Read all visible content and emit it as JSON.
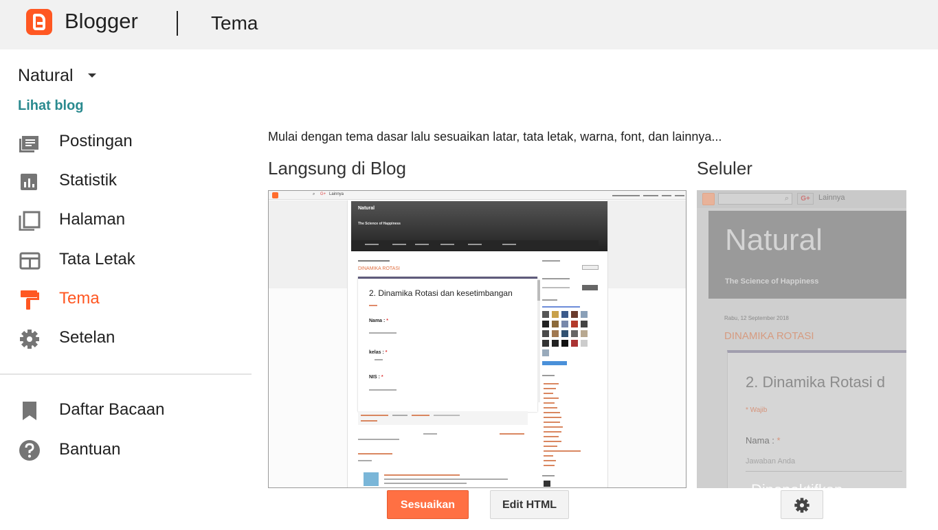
{
  "header": {
    "brand": "Blogger",
    "page_title": "Tema"
  },
  "sidebar": {
    "blog_name": "Natural",
    "view_blog": "Lihat blog",
    "items": [
      {
        "label": "Postingan",
        "icon": "posts-icon"
      },
      {
        "label": "Statistik",
        "icon": "stats-icon"
      },
      {
        "label": "Halaman",
        "icon": "pages-icon"
      },
      {
        "label": "Tata Letak",
        "icon": "layout-icon"
      },
      {
        "label": "Tema",
        "icon": "theme-paint-roller-icon",
        "active": true
      },
      {
        "label": "Setelan",
        "icon": "gear-icon"
      }
    ],
    "secondary_items": [
      {
        "label": "Daftar Bacaan",
        "icon": "bookmark-icon"
      },
      {
        "label": "Bantuan",
        "icon": "help-icon"
      }
    ]
  },
  "main": {
    "intro": "Mulai dengan tema dasar lalu sesuaikan latar, tata letak, warna, font, dan lainnya...",
    "desktop_title": "Langsung di Blog",
    "mobile_title": "Seluler",
    "customize_button": "Sesuaikan",
    "edit_html_button": "Edit HTML"
  },
  "desktop_preview": {
    "blog_name": "Natural",
    "tagline": "The Science of Happiness",
    "post_title": "DINAMIKA ROTASI",
    "card_title": "2. Dinamika Rotasi dan kesetimbangan",
    "field_name": "Nama :",
    "field_class": "kelas :",
    "field_nis": "NIS :",
    "required_mark": "*",
    "topbar_more": "Lainnya"
  },
  "mobile_preview": {
    "more_menu": "Lainnya",
    "gplus": "G+",
    "blog_name": "Natural",
    "tagline": "The Science of Happiness",
    "date": "Rabu, 12 September 2018",
    "post_title": "DINAMIKA ROTASI",
    "card_title": "2. Dinamika Rotasi d",
    "required_label": "* Wajib",
    "field_name": "Nama :",
    "required_mark": "*",
    "answer_placeholder": "Jawaban Anda",
    "cut_text": "Dinonaktifkan"
  },
  "colors": {
    "accent": "#ff5722",
    "link_teal": "#2a8a8f",
    "customize_button": "#ff7043"
  }
}
